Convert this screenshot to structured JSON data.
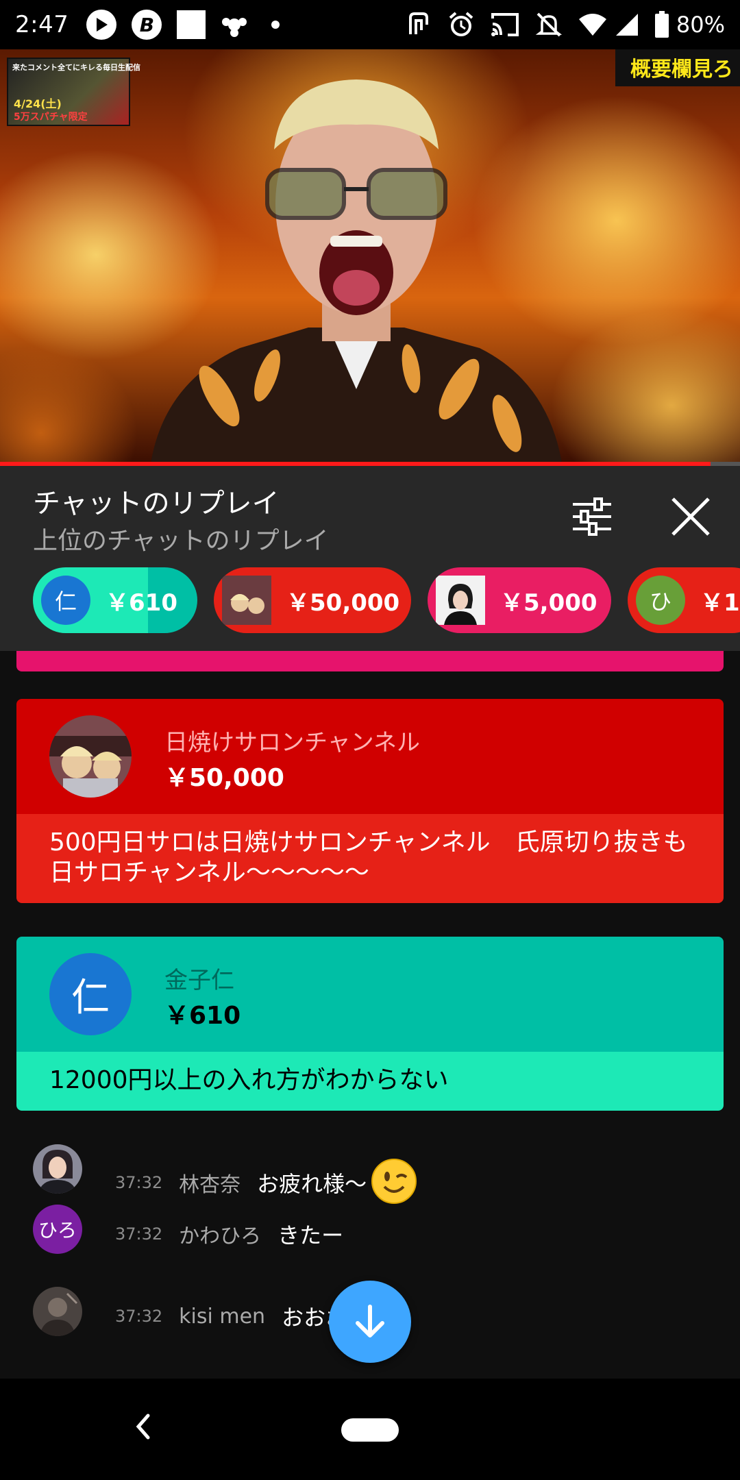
{
  "status_bar": {
    "time": "2:47",
    "battery": "80%",
    "left_icons": [
      "play-circle-icon",
      "b-app-icon",
      "square-app-icon",
      "monkey-app-icon",
      "dot-icon"
    ],
    "right_icons": [
      "nfc-icon",
      "alarm-icon",
      "cast-icon",
      "bell-off-icon",
      "wifi-icon",
      "signal-icon",
      "battery-icon"
    ]
  },
  "video": {
    "thumbnail_line1": "来たコメント全てにキレる毎日生配信",
    "thumbnail_date": "4/24(土)",
    "thumbnail_tag": "5万スパチャ限定",
    "overlay_label": "概要欄見ろ",
    "progress": 0.96,
    "colors": {
      "progress": "#ff1a1a"
    }
  },
  "chat_header": {
    "title": "チャットのリプレイ",
    "subtitle": "上位のチャットのリプレイ",
    "filter_icon": "sliders-icon",
    "close_icon": "close-icon"
  },
  "chips": [
    {
      "avatar_text": "仁",
      "amount": "￥610",
      "bg": "#1de9b6",
      "dark": "#00bfa5",
      "avatar_color": "#1976d2",
      "progress": 0.7
    },
    {
      "avatar_text": "",
      "amount": "￥50,000",
      "bg": "#e62117",
      "dark": "#d00000",
      "avatar_color": "#5a3a3a",
      "progress": 1.0
    },
    {
      "avatar_text": "",
      "amount": "￥5,000",
      "bg": "#e91e63",
      "dark": "#c2185b",
      "avatar_color": "#ffffff",
      "progress": 1.0
    },
    {
      "avatar_text": "ひ",
      "amount": "￥1",
      "bg": "#e62117",
      "dark": "#d00000",
      "avatar_color": "#689f38",
      "progress": 1.0
    }
  ],
  "superchats": [
    {
      "author": "日焼けサロンチャンネル",
      "amount": "￥50,000",
      "message": "500円日サロは日焼けサロンチャンネル　氏原切り抜きも日サロチャンネル〜〜〜〜〜",
      "avatar_text": "",
      "head_color": "#d00000",
      "body_color": "#e62117",
      "name_color": "#ffb3b3",
      "amount_color": "#ffffff",
      "text_color": "#ffffff"
    },
    {
      "author": "金子仁",
      "amount": "￥610",
      "message": "12000円以上の入れ方がわからない",
      "avatar_text": "仁",
      "head_color": "#00bfa5",
      "body_color": "#1de9b6",
      "name_color": "#00695c",
      "amount_color": "#000000",
      "text_color": "#000000",
      "avatar_color": "#1976d2"
    }
  ],
  "messages": [
    {
      "time": "37:32",
      "author": "林杏奈",
      "text": "お疲れ様〜",
      "emoji": "winking-face-emoji",
      "avatar_text": "",
      "avatar_color": "#6b6b7a"
    },
    {
      "time": "37:32",
      "author": "かわひろ",
      "text": "きたー",
      "avatar_text": "ひろ",
      "avatar_color": "#7b1fa2"
    },
    {
      "time": "37:32",
      "author": "kisi men",
      "text": "おおお",
      "avatar_text": "",
      "avatar_color": "#5c5552"
    }
  ],
  "scroll_down_icon": "arrow-down-icon",
  "nav_bar": {
    "back_icon": "back-chevron-icon",
    "home_icon": "home-pill-icon"
  }
}
